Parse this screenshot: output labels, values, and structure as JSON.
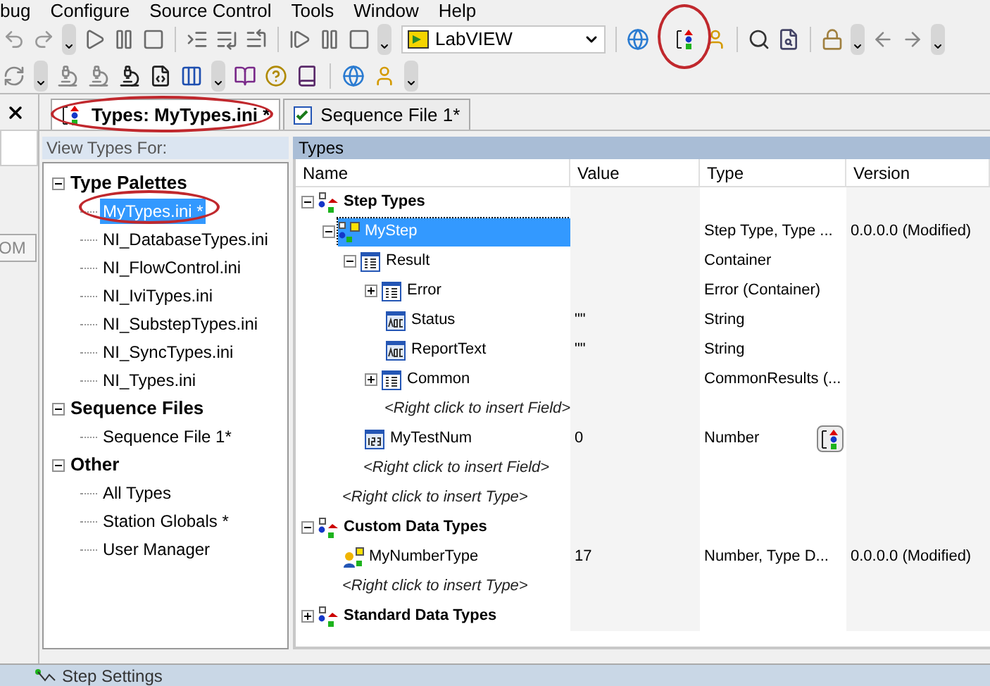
{
  "menu": [
    "bug",
    "Configure",
    "Source Control",
    "Tools",
    "Window",
    "Help"
  ],
  "toolbar": {
    "adapter": "LabVIEW"
  },
  "left_stub": {
    "button": "OM"
  },
  "tabs": [
    {
      "label": "Types: MyTypes.ini *",
      "selected": true
    },
    {
      "label": "Sequence File 1*",
      "selected": false
    }
  ],
  "view_types": {
    "header": "View Types For:",
    "tree": [
      {
        "label": "Type Palettes",
        "expanded": true,
        "selected": false,
        "children": [
          {
            "label": "MyTypes.ini *",
            "selected": true
          },
          {
            "label": "NI_DatabaseTypes.ini",
            "selected": false
          },
          {
            "label": "NI_FlowControl.ini",
            "selected": false
          },
          {
            "label": "NI_IviTypes.ini",
            "selected": false
          },
          {
            "label": "NI_SubstepTypes.ini",
            "selected": false
          },
          {
            "label": "NI_SyncTypes.ini",
            "selected": false
          },
          {
            "label": "NI_Types.ini",
            "selected": false
          }
        ]
      },
      {
        "label": "Sequence Files",
        "expanded": true,
        "selected": false,
        "children": [
          {
            "label": "Sequence File 1*",
            "selected": false
          }
        ]
      },
      {
        "label": "Other",
        "expanded": true,
        "selected": false,
        "children": [
          {
            "label": "All Types",
            "selected": false
          },
          {
            "label": "Station Globals *",
            "selected": false
          },
          {
            "label": "User Manager",
            "selected": false
          }
        ]
      }
    ]
  },
  "types": {
    "title": "Types",
    "columns": [
      "Name",
      "Value",
      "Type",
      "Version"
    ],
    "rows": [
      {
        "kind": "group",
        "name": "Step Types",
        "expanded": true,
        "selected": false,
        "children": [
          {
            "kind": "step",
            "name": "MyStep",
            "type": "Step Type, Type ...",
            "version": "0.0.0.0 (Modified)",
            "expanded": true,
            "selected": true,
            "children": [
              {
                "kind": "container",
                "name": "Result",
                "type": "Container",
                "expanded": true,
                "selected": false,
                "children": [
                  {
                    "kind": "container",
                    "name": "Error",
                    "type": "Error (Container)",
                    "expanded": false,
                    "selected": false
                  },
                  {
                    "kind": "string",
                    "name": "Status",
                    "value": "\"\"",
                    "type": "String",
                    "selected": false
                  },
                  {
                    "kind": "string",
                    "name": "ReportText",
                    "value": "\"\"",
                    "type": "String",
                    "selected": false
                  },
                  {
                    "kind": "container",
                    "name": "Common",
                    "type": "CommonResults (...",
                    "expanded": false,
                    "selected": false
                  },
                  {
                    "kind": "placeholder",
                    "name": "<Right click to insert Field>",
                    "selected": false
                  }
                ]
              },
              {
                "kind": "number",
                "name": "MyTestNum",
                "value": "0",
                "type": "Number",
                "type_button": true,
                "selected": false
              },
              {
                "kind": "placeholder",
                "name": "<Right click to insert Field>",
                "selected": false
              }
            ]
          },
          {
            "kind": "placeholder",
            "name": "<Right click to insert Type>",
            "selected": false
          }
        ]
      },
      {
        "kind": "group",
        "name": "Custom Data Types",
        "expanded": true,
        "selected": false,
        "children": [
          {
            "kind": "datatype",
            "name": "MyNumberType",
            "value": "17",
            "type": "Number, Type D...",
            "version": "0.0.0.0 (Modified)",
            "selected": false
          },
          {
            "kind": "placeholder",
            "name": "<Right click to insert Type>",
            "selected": false
          }
        ]
      },
      {
        "kind": "group",
        "name": "Standard Data Types",
        "expanded": false,
        "selected": false
      }
    ]
  },
  "status_bar": {
    "label": "Step Settings"
  }
}
